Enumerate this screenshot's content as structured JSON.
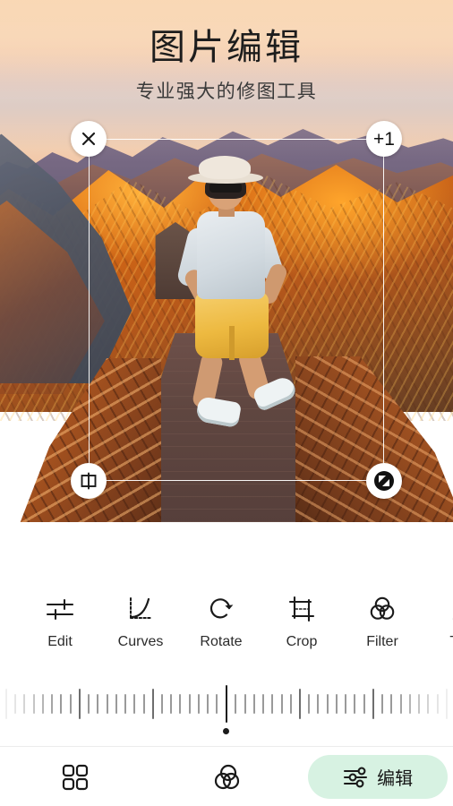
{
  "header": {
    "title": "图片编辑",
    "subtitle": "专业强大的修图工具"
  },
  "canvas": {
    "handles": {
      "close": {
        "icon": "close-icon",
        "label": ""
      },
      "count_badge": {
        "icon": "plus-one-badge",
        "label": "+1"
      },
      "mirror": {
        "icon": "mirror-flip-icon",
        "label": ""
      },
      "resize": {
        "icon": "resize-diagonal-icon",
        "label": ""
      }
    }
  },
  "toolbar": {
    "items": [
      {
        "label": "Edit",
        "icon": "sliders-icon"
      },
      {
        "label": "Curves",
        "icon": "curves-icon"
      },
      {
        "label": "Rotate",
        "icon": "rotate-cw-icon"
      },
      {
        "label": "Crop",
        "icon": "crop-icon"
      },
      {
        "label": "Filter",
        "icon": "filter-circles-icon"
      },
      {
        "label": "Text",
        "icon": "text-a-icon"
      }
    ]
  },
  "slider": {
    "name": "intensity-ruler",
    "value": 0,
    "min": -50,
    "max": 50,
    "total_ticks": 49,
    "major_every": 8,
    "active_index": 24
  },
  "bottom_nav": {
    "items": [
      {
        "label": "",
        "icon": "grid-icon",
        "active": false
      },
      {
        "label": "",
        "icon": "filter-circles-icon",
        "active": false
      },
      {
        "label": "编辑",
        "icon": "adjust-sliders-icon",
        "active": true
      }
    ],
    "active_pill_color": "#d7f2e2"
  }
}
